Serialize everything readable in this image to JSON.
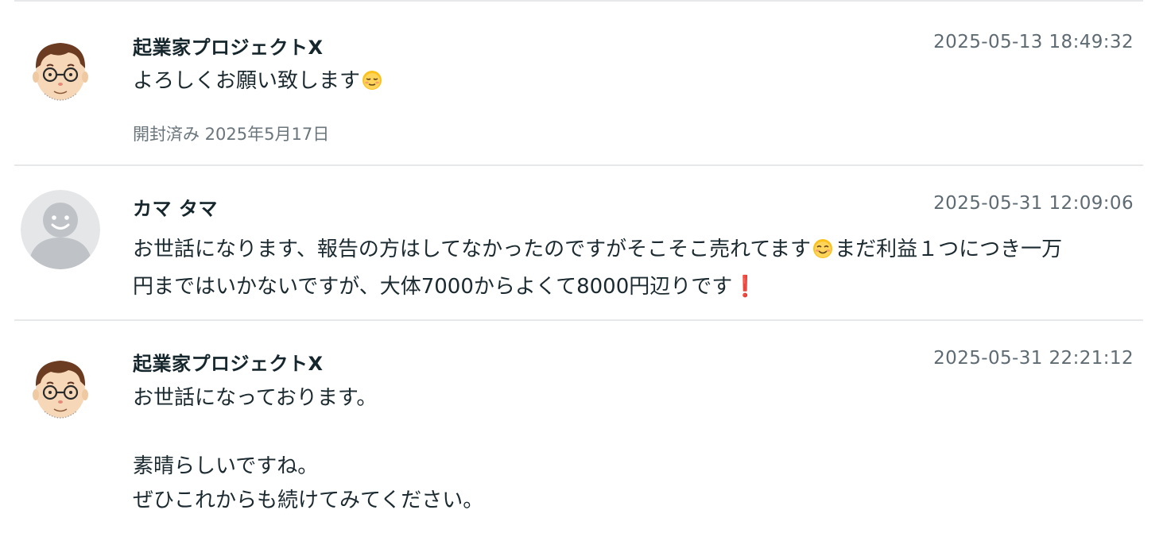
{
  "messages": [
    {
      "sender": "起業家プロジェクトX",
      "timestamp": "2025-05-13 18:49:32",
      "avatar": "cartoon-man-with-glasses",
      "text": "よろしくお願い致します",
      "emoji": "relieved-face",
      "read_receipt": "開封済み 2025年5月17日"
    },
    {
      "sender": "カマ タマ",
      "timestamp": "2025-05-31 12:09:06",
      "avatar": "default-user-silhouette",
      "line1_a": "お世話になります、報告の方はしてなかったのですがそこそこ売れてます",
      "line1_emoji": "smiling-face",
      "line1_b": "まだ利益１つにつき一万",
      "line2": "円まではいかないですが、大体7000からよくて8000円辺りです",
      "line2_emoji": "exclamation-mark",
      "line2_emoji_glyph": "❗"
    },
    {
      "sender": "起業家プロジェクトX",
      "timestamp": "2025-05-31 22:21:12",
      "avatar": "cartoon-man-with-glasses",
      "line1": "お世話になっております。",
      "line3": "素晴らしいですね。",
      "line4": "ぜひこれからも続けてみてください。"
    }
  ],
  "colors": {
    "divider": "#e6e8ea",
    "timestamp": "#5f6b73",
    "exclamation": "#d0232a",
    "default_avatar_bg": "#e4e6e8",
    "default_avatar_fg": "#bfc3c7"
  }
}
